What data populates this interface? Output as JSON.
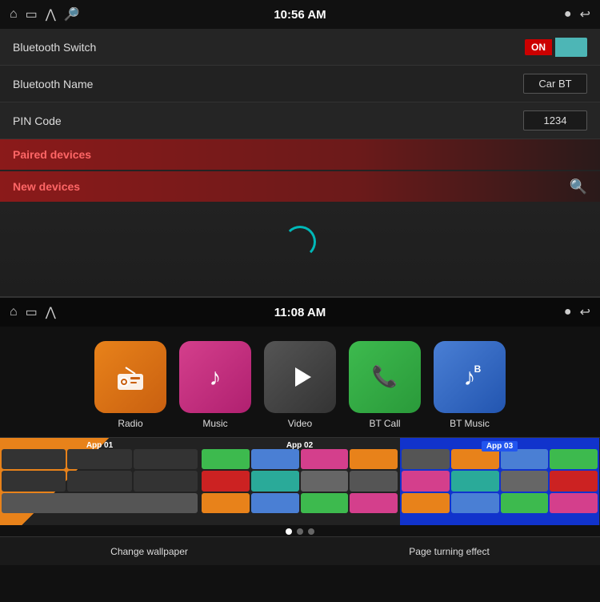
{
  "top_screen": {
    "status_bar": {
      "time": "10:56 AM",
      "icons_left": [
        "home",
        "screen",
        "chevron-up",
        "usb"
      ],
      "icons_right": [
        "location",
        "back"
      ]
    },
    "settings": {
      "bluetooth_switch_label": "Bluetooth Switch",
      "bluetooth_switch_state": "ON",
      "bluetooth_name_label": "Bluetooth Name",
      "bluetooth_name_value": "Car BT",
      "pin_code_label": "PIN Code",
      "pin_code_value": "1234",
      "paired_devices_label": "Paired devices",
      "new_devices_label": "New devices"
    }
  },
  "bottom_screen": {
    "status_bar": {
      "time": "11:08 AM",
      "icons_left": [
        "home",
        "screen",
        "chevron-up"
      ],
      "icons_right": [
        "location",
        "back"
      ]
    },
    "apps": [
      {
        "id": "radio",
        "label": "Radio",
        "icon": "📻",
        "color_class": "icon-radio"
      },
      {
        "id": "music",
        "label": "Music",
        "icon": "♪",
        "color_class": "icon-music"
      },
      {
        "id": "video",
        "label": "Video",
        "icon": "▶",
        "color_class": "icon-video"
      },
      {
        "id": "btcall",
        "label": "BT Call",
        "icon": "📞",
        "color_class": "icon-btcall"
      },
      {
        "id": "btmusic",
        "label": "BT Music",
        "icon": "♪",
        "color_class": "icon-btmusic"
      }
    ],
    "thumbnails": [
      {
        "id": "app01",
        "label": "App 01",
        "active": false
      },
      {
        "id": "app02",
        "label": "App 02",
        "active": false
      },
      {
        "id": "app03",
        "label": "App 03",
        "active": true
      }
    ],
    "dots": [
      true,
      false,
      false
    ],
    "bottom_bar": {
      "change_wallpaper": "Change wallpaper",
      "page_turning": "Page turning effect"
    }
  }
}
